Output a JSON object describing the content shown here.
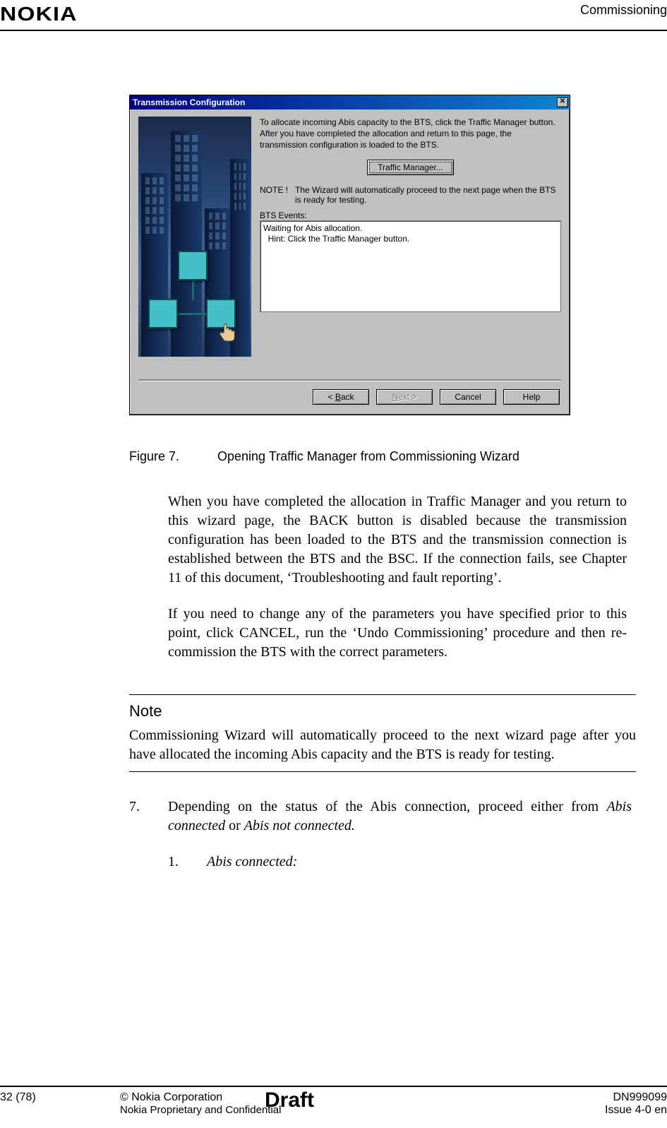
{
  "header": {
    "brand": "NOKIA",
    "section": "Commissioning"
  },
  "dialog": {
    "title": "Transmission Configuration",
    "close_glyph": "✕",
    "instruction": "To allocate incoming Abis capacity to the BTS, click the Traffic Manager button. After you have completed the allocation and return to this page, the transmission configuration is loaded to the BTS.",
    "traffic_manager_btn": "Traffic Manager...",
    "note_label": "NOTE !",
    "note_text": "The Wizard will automatically proceed to the next page when the BTS is ready for testing.",
    "events_label": "BTS Events:",
    "events_line1": "Waiting for Abis allocation.",
    "events_line2": "  Hint: Click the Traffic Manager button.",
    "btn_back": "< Back",
    "btn_next": "Next >",
    "btn_cancel": "Cancel",
    "btn_help": "Help"
  },
  "figure": {
    "number": "Figure 7.",
    "caption": "Opening Traffic Manager from Commissioning Wizard"
  },
  "para1": "When you have completed the allocation in Traffic Manager and you return to this wizard page, the BACK button is disabled because the transmission configuration has been loaded to the BTS and the transmission connection is established between the BTS and the BSC. If the connection fails, see Chapter 11 of this document, ‘Troubleshooting and fault reporting’.",
  "para2": "If you need to change any of the parameters you have specified prior to this point, click CANCEL, run the ‘Undo Commissioning’ procedure and then re-commission the BTS with the correct parameters.",
  "note": {
    "title": "Note",
    "body": "Commissioning Wizard will automatically proceed to the next wizard page after you have allocated the incoming Abis capacity and the BTS is ready for testing."
  },
  "step7": {
    "num": "7.",
    "text_pre": "Depending on the status of the Abis connection, proceed either from ",
    "text_i1": "Abis connected",
    "text_mid": " or ",
    "text_i2": "Abis not connected.",
    "sub_num": "1.",
    "sub_text": "Abis connected:"
  },
  "footer": {
    "page": "32 (78)",
    "copyright": "© Nokia Corporation",
    "confidential": "Nokia Proprietary and Confidential",
    "draft": "Draft",
    "doc_id": "DN999099",
    "issue": "Issue 4-0 en"
  }
}
